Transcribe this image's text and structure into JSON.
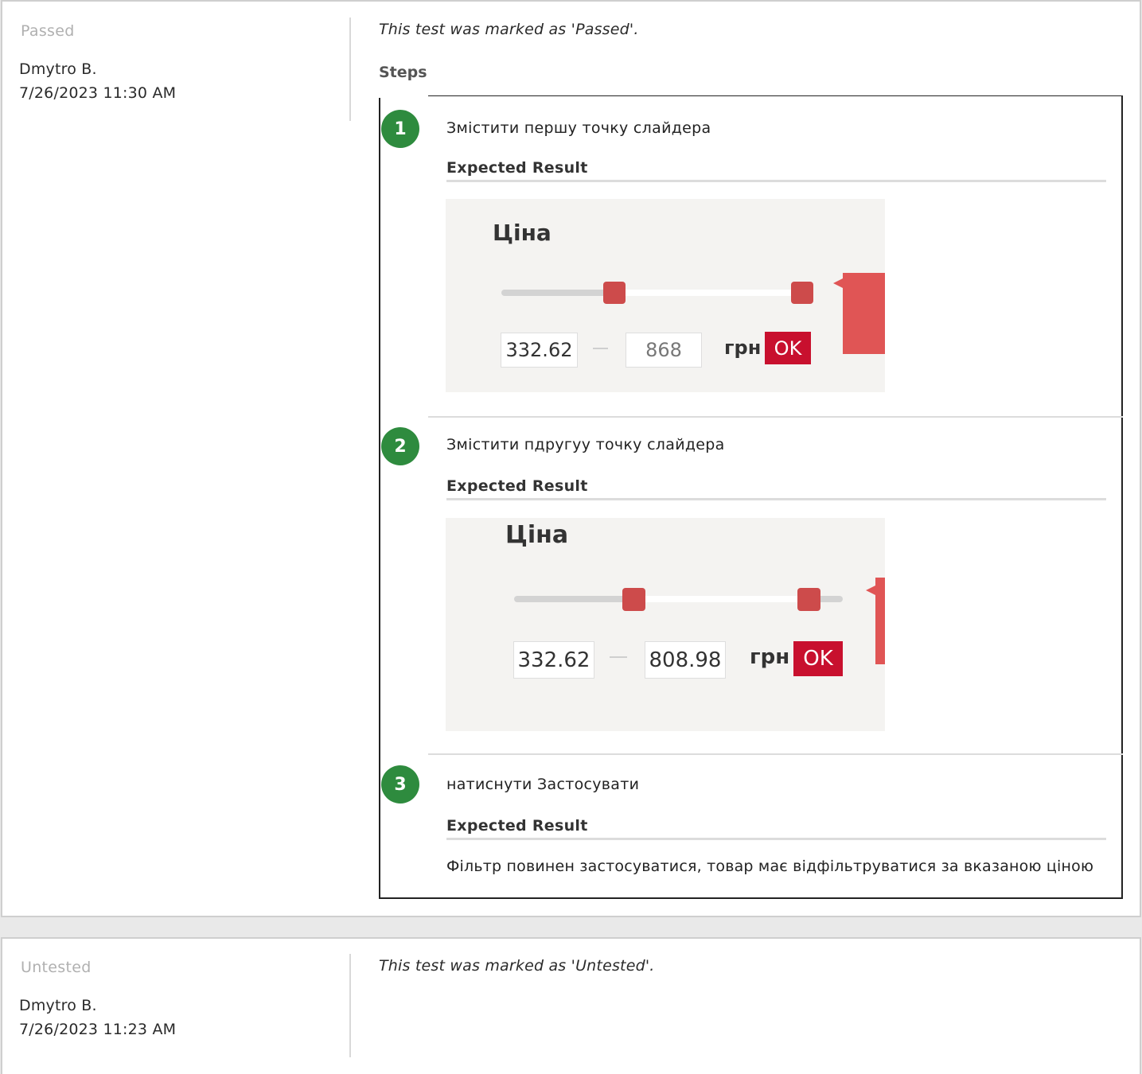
{
  "results": [
    {
      "status": "Passed",
      "user": "Dmytro B.",
      "timestamp": "7/26/2023 11:30 AM",
      "message": "This test was marked as 'Passed'.",
      "steps_heading": "Steps",
      "steps": [
        {
          "number": "1",
          "text": "Змістити першу точку слайдера",
          "expected_label": "Expected Result",
          "screenshot": {
            "title": "Ціна",
            "min": "332.62",
            "max": "868",
            "currency": "грн",
            "ok": "OK"
          }
        },
        {
          "number": "2",
          "text": "Змістити пдругуу точку слайдера",
          "expected_label": "Expected Result",
          "screenshot": {
            "title": "Ціна",
            "min": "332.62",
            "max": "808.98",
            "currency": "грн",
            "ok": "OK"
          }
        },
        {
          "number": "3",
          "text": "натиснути Застосувати",
          "expected_label": "Expected Result",
          "result_text": "Фільтр повинен застосуватися, товар має відфільтруватися за вказаною ціною"
        }
      ]
    },
    {
      "status": "Untested",
      "user": "Dmytro B.",
      "timestamp": "7/26/2023 11:23 AM",
      "message": "This test was marked as 'Untested'."
    }
  ],
  "colors": {
    "step_badge": "#2e8b3e",
    "ok_button": "#c8102e",
    "slider_handle": "#cd4b4b",
    "status_text": "#b0b0b0"
  }
}
